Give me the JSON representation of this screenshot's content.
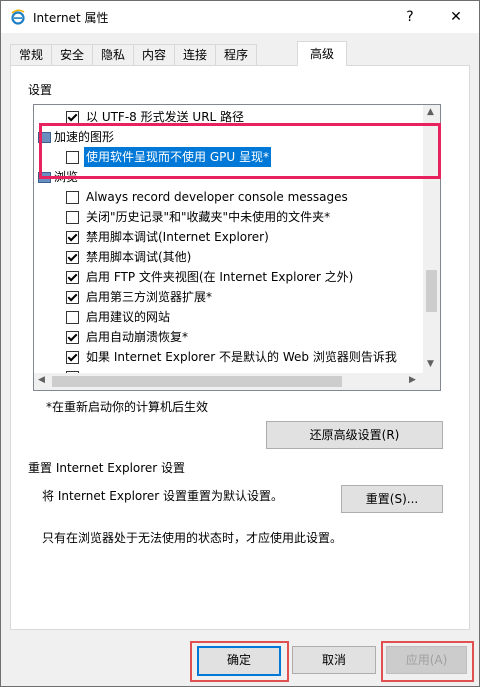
{
  "window": {
    "title": "Internet 属性",
    "help_glyph": "?",
    "close_glyph": "✕"
  },
  "tabs": [
    {
      "label": "常规"
    },
    {
      "label": "安全"
    },
    {
      "label": "隐私"
    },
    {
      "label": "内容"
    },
    {
      "label": "连接"
    },
    {
      "label": "程序"
    },
    {
      "label": "高级",
      "active": true
    }
  ],
  "settings": {
    "group_label": "设置",
    "items": [
      {
        "label": "以 UTF-8 形式发送 URL 路径",
        "checked": true,
        "type": "checkbox"
      },
      {
        "label": "加速的图形",
        "type": "section"
      },
      {
        "label": "使用软件呈现而不使用 GPU 呈现*",
        "checked": false,
        "type": "checkbox",
        "selected": true
      },
      {
        "label": "浏览",
        "type": "section"
      },
      {
        "label": "Always record developer console messages",
        "checked": false,
        "type": "checkbox"
      },
      {
        "label": "关闭\"历史记录\"和\"收藏夹\"中未使用的文件夹*",
        "checked": false,
        "type": "checkbox"
      },
      {
        "label": "禁用脚本调试(Internet Explorer)",
        "checked": true,
        "type": "checkbox"
      },
      {
        "label": "禁用脚本调试(其他)",
        "checked": true,
        "type": "checkbox"
      },
      {
        "label": "启用 FTP 文件夹视图(在 Internet Explorer 之外)",
        "checked": true,
        "type": "checkbox"
      },
      {
        "label": "启用第三方浏览器扩展*",
        "checked": true,
        "type": "checkbox"
      },
      {
        "label": "启用建议的网站",
        "checked": false,
        "type": "checkbox"
      },
      {
        "label": "启用自动崩溃恢复*",
        "checked": true,
        "type": "checkbox"
      },
      {
        "label": "如果 Internet Explorer 不是默认的 Web 浏览器则告诉我",
        "checked": true,
        "type": "checkbox"
      },
      {
        "label": "",
        "checked": false,
        "type": "checkbox"
      }
    ],
    "restart_note": "*在重新启动你的计算机后生效",
    "restore_button": "还原高级设置(R)"
  },
  "reset": {
    "group_label": "重置 Internet Explorer 设置",
    "description": "将 Internet Explorer 设置重置为默认设置。",
    "button": "重置(S)...",
    "warning": "只有在浏览器处于无法使用的状态时，才应使用此设置。"
  },
  "footer": {
    "ok": "确定",
    "cancel": "取消",
    "apply": "应用(A)"
  },
  "colors": {
    "highlight": "#e8215f",
    "selection": "#0078d7"
  }
}
